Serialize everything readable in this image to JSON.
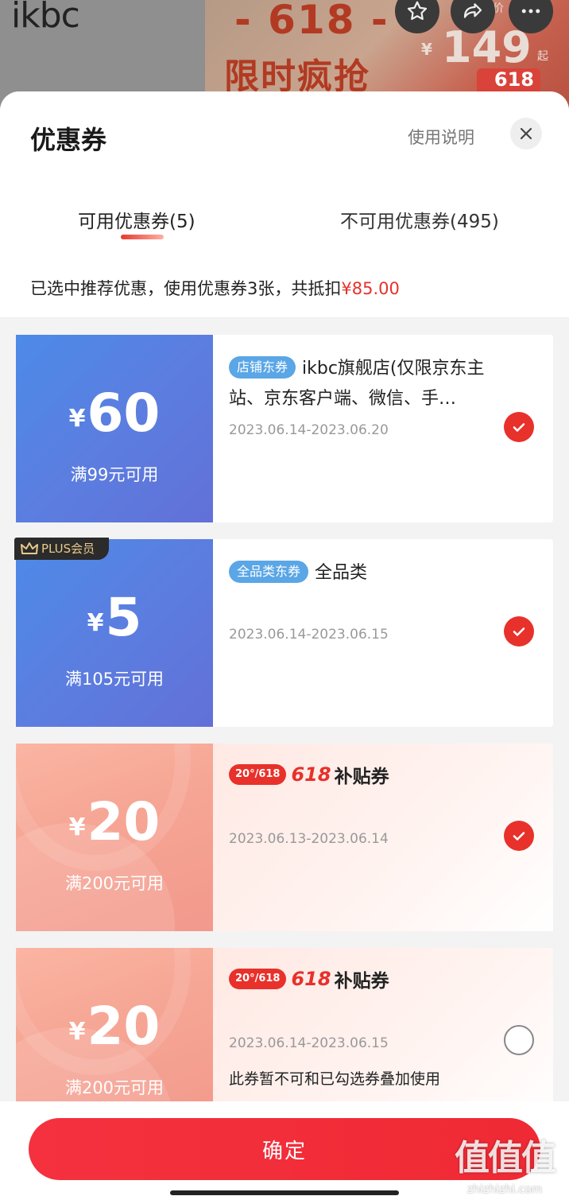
{
  "background": {
    "logo": "ikbc",
    "promo_618": "- 618 -",
    "promo_text": "限时疯抢",
    "promo_yen": "¥",
    "promo_price": "149",
    "promo_qi": "起",
    "promo_jia": "价",
    "badge": "618"
  },
  "sheet": {
    "title": "优惠券",
    "help_label": "使用说明",
    "tabs": [
      {
        "label": "可用优惠券(5)"
      },
      {
        "label": "不可用优惠券(495)"
      }
    ],
    "hint_prefix": "已选中推荐优惠，使用优惠券3张，共抵扣",
    "hint_amount": "¥85.00"
  },
  "coupons": [
    {
      "yen": "¥",
      "amount": "60",
      "condition": "满99元可用",
      "tag": "店铺东券",
      "name": "ikbc旗舰店(仅限京东主站、京东客户端、微信、手…",
      "date": "2023.06.14-2023.06.20",
      "checked": true
    },
    {
      "plus_badge": "PLUS会员",
      "yen": "¥",
      "amount": "5",
      "condition": "满105元可用",
      "tag": "全品类东券",
      "name": "全品类",
      "date": "2023.06.14-2023.06.15",
      "checked": true
    },
    {
      "yen": "¥",
      "amount": "20",
      "condition": "满200元可用",
      "sub_pill": "20°/618",
      "sub_618": "618",
      "sub_text": "补贴券",
      "date": "2023.06.13-2023.06.14",
      "checked": true
    },
    {
      "yen": "¥",
      "amount": "20",
      "condition": "满200元可用",
      "sub_pill": "20°/618",
      "sub_618": "618",
      "sub_text": "补贴券",
      "date": "2023.06.14-2023.06.15",
      "note": "此券暂不可和已勾选券叠加使用",
      "checked": false
    }
  ],
  "footer": {
    "confirm_label": "确定"
  },
  "watermark": {
    "big": "值值值",
    "small": "zhizhizhi.com"
  },
  "colors": {
    "accent": "#e8312a",
    "coupon_blue": "#5b7ee0",
    "coupon_pink": "#f6a695"
  }
}
